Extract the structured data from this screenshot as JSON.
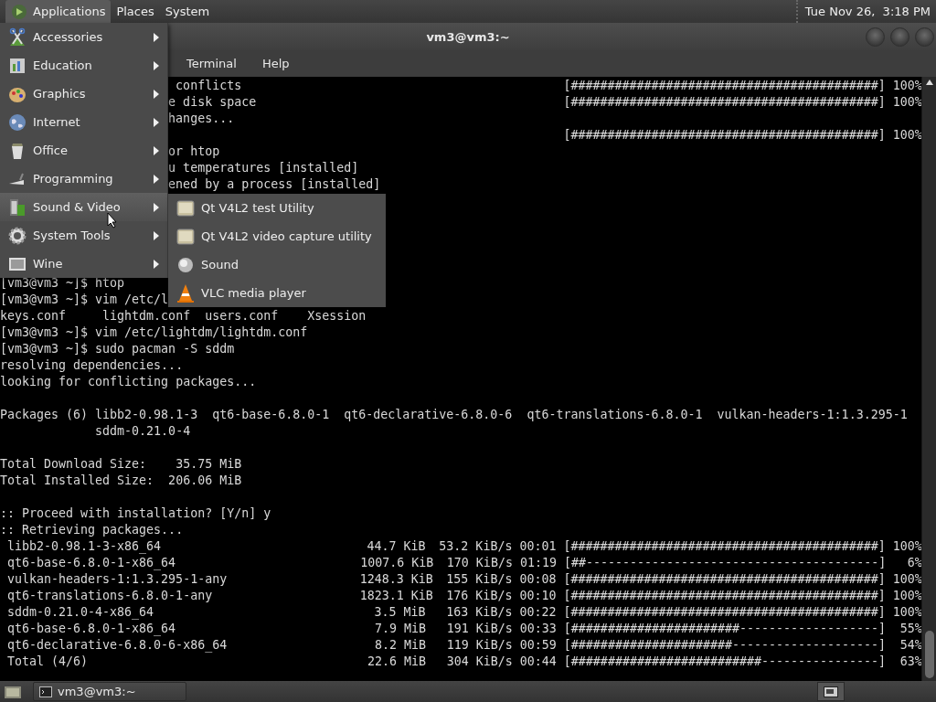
{
  "top_panel": {
    "menus": [
      {
        "label": "Applications",
        "selected": true
      },
      {
        "label": "Places",
        "selected": false
      },
      {
        "label": "System",
        "selected": false
      }
    ],
    "clock": "Tue Nov 26,  3:18 PM"
  },
  "applications_menu": {
    "items": [
      {
        "label": "Accessories",
        "submenu": true,
        "selected": false
      },
      {
        "label": "Education",
        "submenu": true,
        "selected": false
      },
      {
        "label": "Graphics",
        "submenu": true,
        "selected": false
      },
      {
        "label": "Internet",
        "submenu": true,
        "selected": false
      },
      {
        "label": "Office",
        "submenu": true,
        "selected": false
      },
      {
        "label": "Programming",
        "submenu": true,
        "selected": false
      },
      {
        "label": "Sound & Video",
        "submenu": true,
        "selected": true
      },
      {
        "label": "System Tools",
        "submenu": true,
        "selected": false
      },
      {
        "label": "Wine",
        "submenu": true,
        "selected": false
      }
    ]
  },
  "submenu": {
    "items": [
      {
        "label": "Qt V4L2 test Utility"
      },
      {
        "label": "Qt V4L2 video capture utility"
      },
      {
        "label": "Sound"
      },
      {
        "label": "VLC media player"
      }
    ]
  },
  "window": {
    "title": "vm3@vm3:~",
    "menu": [
      "Terminal",
      "Help"
    ]
  },
  "terminal": {
    "lines": [
      {
        "kind": "partial",
        "text": " conflicts",
        "bar": "[##########################################]",
        "percent": "100%"
      },
      {
        "kind": "partial",
        "text": "e disk space",
        "bar": "[##########################################]",
        "percent": "100%"
      },
      {
        "kind": "partial",
        "text": "hanges..."
      },
      {
        "kind": "partial",
        "bar": "[##########################################]",
        "percent": "100%"
      },
      {
        "kind": "partial",
        "text": "or htop"
      },
      {
        "kind": "partial",
        "text": "u temperatures [installed]"
      },
      {
        "kind": "partial",
        "text": "ened by a process [installed]"
      },
      {
        "kind": "blank"
      },
      {
        "kind": "blank"
      },
      {
        "kind": "blank"
      },
      {
        "kind": "blank"
      },
      {
        "kind": "blank"
      },
      {
        "kind": "text",
        "text": "[vm3@vm3 ~]$ htop"
      },
      {
        "kind": "text",
        "text": "[vm3@vm3 ~]$ vim /etc/l"
      },
      {
        "kind": "text",
        "text": "keys.conf     lightdm.conf  users.conf    Xsession"
      },
      {
        "kind": "text",
        "text": "[vm3@vm3 ~]$ vim /etc/lightdm/lightdm.conf"
      },
      {
        "kind": "text",
        "text": "[vm3@vm3 ~]$ sudo pacman -S sddm"
      },
      {
        "kind": "text",
        "text": "resolving dependencies..."
      },
      {
        "kind": "text",
        "text": "looking for conflicting packages..."
      },
      {
        "kind": "blank"
      },
      {
        "kind": "text",
        "text": "Packages (6) libb2-0.98.1-3  qt6-base-6.8.0-1  qt6-declarative-6.8.0-6  qt6-translations-6.8.0-1  vulkan-headers-1:1.3.295-1"
      },
      {
        "kind": "text",
        "text": "             sddm-0.21.0-4"
      },
      {
        "kind": "blank"
      },
      {
        "kind": "text",
        "text": "Total Download Size:    35.75 MiB"
      },
      {
        "kind": "text",
        "text": "Total Installed Size:  206.06 MiB"
      },
      {
        "kind": "blank"
      },
      {
        "kind": "text",
        "text": ":: Proceed with installation? [Y/n] y"
      },
      {
        "kind": "text",
        "text": ":: Retrieving packages..."
      },
      {
        "kind": "download",
        "name": "libb2-0.98.1-3-x86_64",
        "size": "44.7 KiB",
        "rate": "53.2 KiB/s",
        "time": "00:01",
        "bar": "[##########################################]",
        "percent": "100%"
      },
      {
        "kind": "download",
        "name": "qt6-base-6.8.0-1-x86_64",
        "size": "1007.6 KiB",
        "rate": "170 KiB/s",
        "time": "01:19",
        "bar": "[##----------------------------------------]",
        "percent": "6%"
      },
      {
        "kind": "download",
        "name": "vulkan-headers-1:1.3.295-1-any",
        "size": "1248.3 KiB",
        "rate": "155 KiB/s",
        "time": "00:08",
        "bar": "[##########################################]",
        "percent": "100%"
      },
      {
        "kind": "download",
        "name": "qt6-translations-6.8.0-1-any",
        "size": "1823.1 KiB",
        "rate": "176 KiB/s",
        "time": "00:10",
        "bar": "[##########################################]",
        "percent": "100%"
      },
      {
        "kind": "download",
        "name": "sddm-0.21.0-4-x86_64",
        "size": "3.5 MiB",
        "rate": "163 KiB/s",
        "time": "00:22",
        "bar": "[##########################################]",
        "percent": "100%"
      },
      {
        "kind": "download",
        "name": "qt6-base-6.8.0-1-x86_64",
        "size": "7.9 MiB",
        "rate": "191 KiB/s",
        "time": "00:33",
        "bar": "[#######################-------------------]",
        "percent": "55%"
      },
      {
        "kind": "download",
        "name": "qt6-declarative-6.8.0-6-x86_64",
        "size": "8.2 MiB",
        "rate": "119 KiB/s",
        "time": "00:59",
        "bar": "[######################--------------------]",
        "percent": "54%"
      },
      {
        "kind": "download",
        "name": "Total (4/6)",
        "size": "22.6 MiB",
        "rate": "304 KiB/s",
        "time": "00:44",
        "bar": "[##########################----------------]",
        "percent": "63%"
      }
    ]
  },
  "taskbar": {
    "tasks": [
      {
        "label": "vm3@vm3:~",
        "selected": false
      }
    ]
  }
}
